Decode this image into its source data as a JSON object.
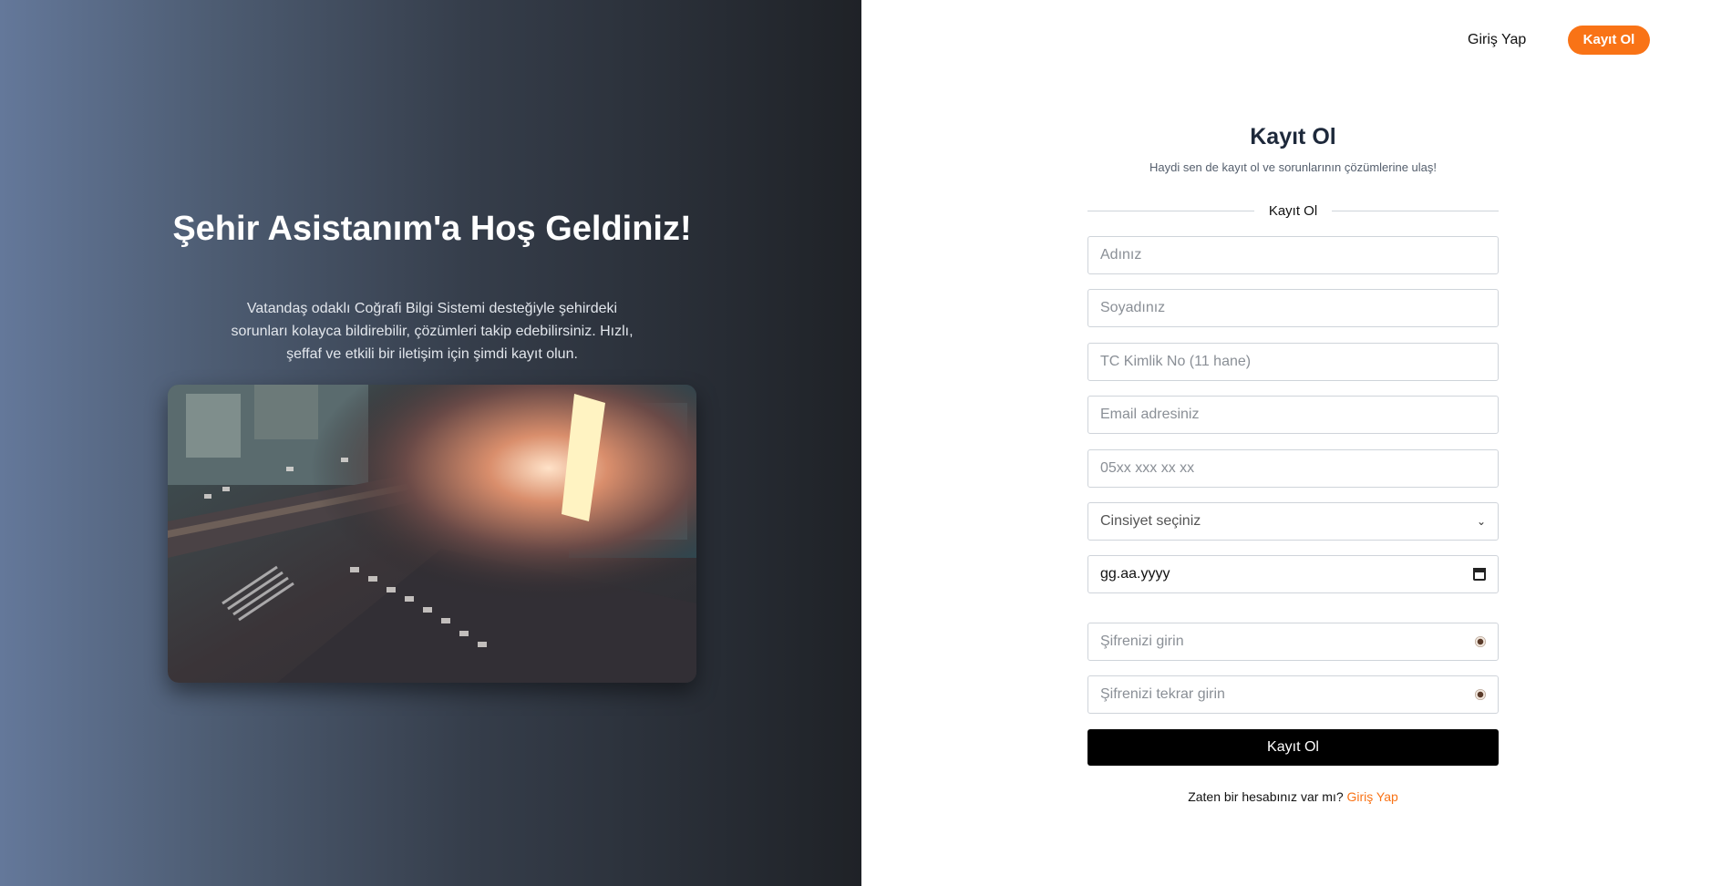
{
  "hero": {
    "title": "Şehir Asistanım'a Hoş Geldiniz!",
    "description": "Vatandaş odaklı Coğrafi Bilgi Sistemi desteğiyle şehirdeki sorunları kolayca bildirebilir, çözümleri takip edebilirsiniz. Hızlı, şeffaf ve etkili bir iletişim için şimdi kayıt olun."
  },
  "nav": {
    "login_label": "Giriş Yap",
    "signup_label": "Kayıt Ol"
  },
  "form": {
    "title": "Kayıt Ol",
    "subtitle": "Haydi sen de kayıt ol ve sorunlarının çözümlerine ulaş!",
    "divider_label": "Kayıt Ol",
    "first_name_placeholder": "Adınız",
    "last_name_placeholder": "Soyadınız",
    "tc_placeholder": "TC Kimlik No (11 hane)",
    "email_placeholder": "Email adresiniz",
    "phone_placeholder": "05xx xxx xx xx",
    "gender_selected": "Cinsiyet seçiniz",
    "date_value": "gg.aa.yyyy",
    "password_placeholder": "Şifrenizi girin",
    "password_repeat_placeholder": "Şifrenizi tekrar girin",
    "submit_label": "Kayıt Ol",
    "footer_text": "Zaten bir hesabınız var mı?",
    "footer_link": "Giriş Yap"
  },
  "colors": {
    "accent": "#f97316",
    "submit_bg": "#000000"
  }
}
